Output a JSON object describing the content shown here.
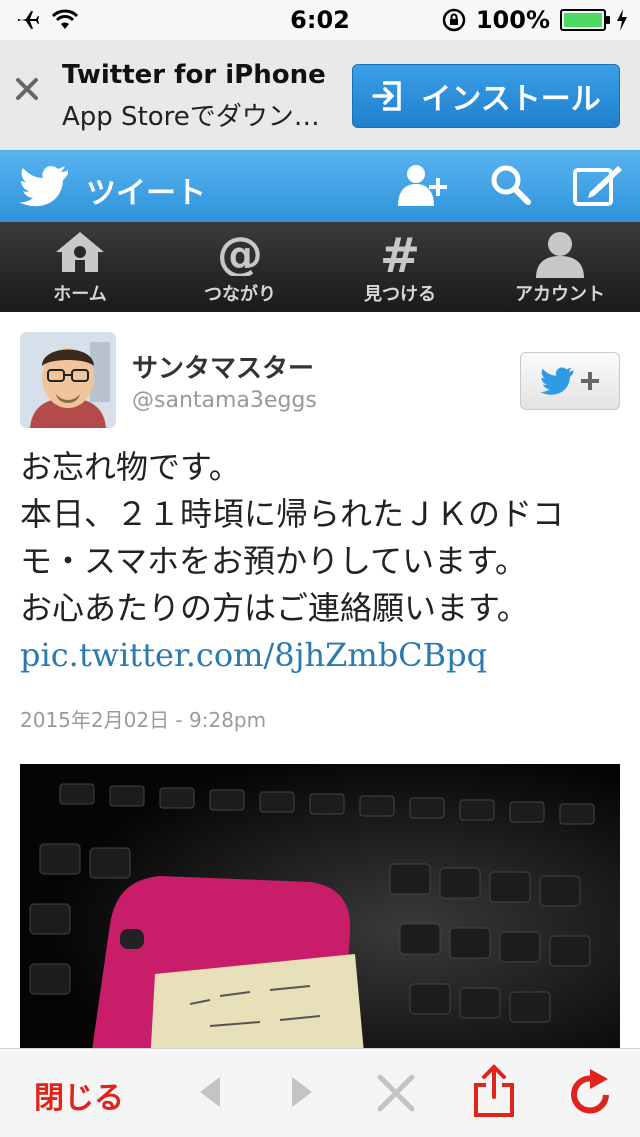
{
  "status_bar": {
    "time": "6:02",
    "battery": "100%",
    "battery_level": 1.0
  },
  "app_banner": {
    "title": "Twitter for iPhone",
    "subtitle": "App Storeでダウンロード",
    "install_label": "インストール"
  },
  "nav": {
    "title": "ツイート"
  },
  "tabs": [
    {
      "label": "ホーム",
      "icon": "home-icon"
    },
    {
      "label": "つながり",
      "icon": "at-icon"
    },
    {
      "label": "見つける",
      "icon": "hashtag-icon"
    },
    {
      "label": "アカウント",
      "icon": "person-icon"
    }
  ],
  "tweet": {
    "author_name": "サンタマスター",
    "handle": "@santama3eggs",
    "lines": [
      "お忘れ物です。",
      "本日、２１時頃に帰られたＪＫのドコ",
      "モ・スマホをお預かりしています。",
      "お心あたりの方はご連絡願います。"
    ],
    "link": "pic.twitter.com/8jhZmbCBpq",
    "timestamp": "2015年2月02日 - 9:28pm"
  },
  "bottom_bar": {
    "close_label": "閉じる"
  },
  "colors": {
    "accent_blue": "#2f93dc",
    "link": "#2a7ab0",
    "close_red": "#e0241b",
    "battery_green": "#4cd964"
  }
}
